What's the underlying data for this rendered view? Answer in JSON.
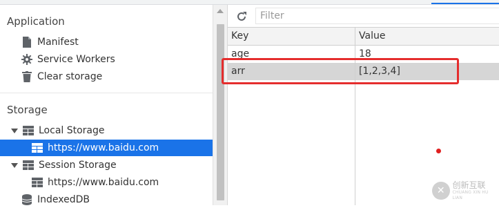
{
  "sidebar": {
    "application_title": "Application",
    "application_items": [
      {
        "label": "Manifest",
        "icon": "file-icon"
      },
      {
        "label": "Service Workers",
        "icon": "gear-icon"
      },
      {
        "label": "Clear storage",
        "icon": "trash-icon"
      }
    ],
    "storage_title": "Storage",
    "local_storage": {
      "label": "Local Storage",
      "child": "https://www.baidu.com"
    },
    "session_storage": {
      "label": "Session Storage",
      "child": "https://www.baidu.com"
    },
    "indexeddb": {
      "label": "IndexedDB"
    }
  },
  "toolbar": {
    "filter_placeholder": "Filter",
    "refresh_icon": "refresh-icon"
  },
  "table": {
    "headers": {
      "key": "Key",
      "value": "Value"
    },
    "rows": [
      {
        "key": "age",
        "value": "18"
      },
      {
        "key": "arr",
        "value": "[1,2,3,4]"
      }
    ]
  },
  "watermark": {
    "text_cn": "创新互联",
    "text_en": "CHUANG XIN HU LIAN"
  },
  "colors": {
    "selection": "#1a73e8",
    "highlight_box": "#e52d2d",
    "selected_row": "#d6d6d6"
  }
}
